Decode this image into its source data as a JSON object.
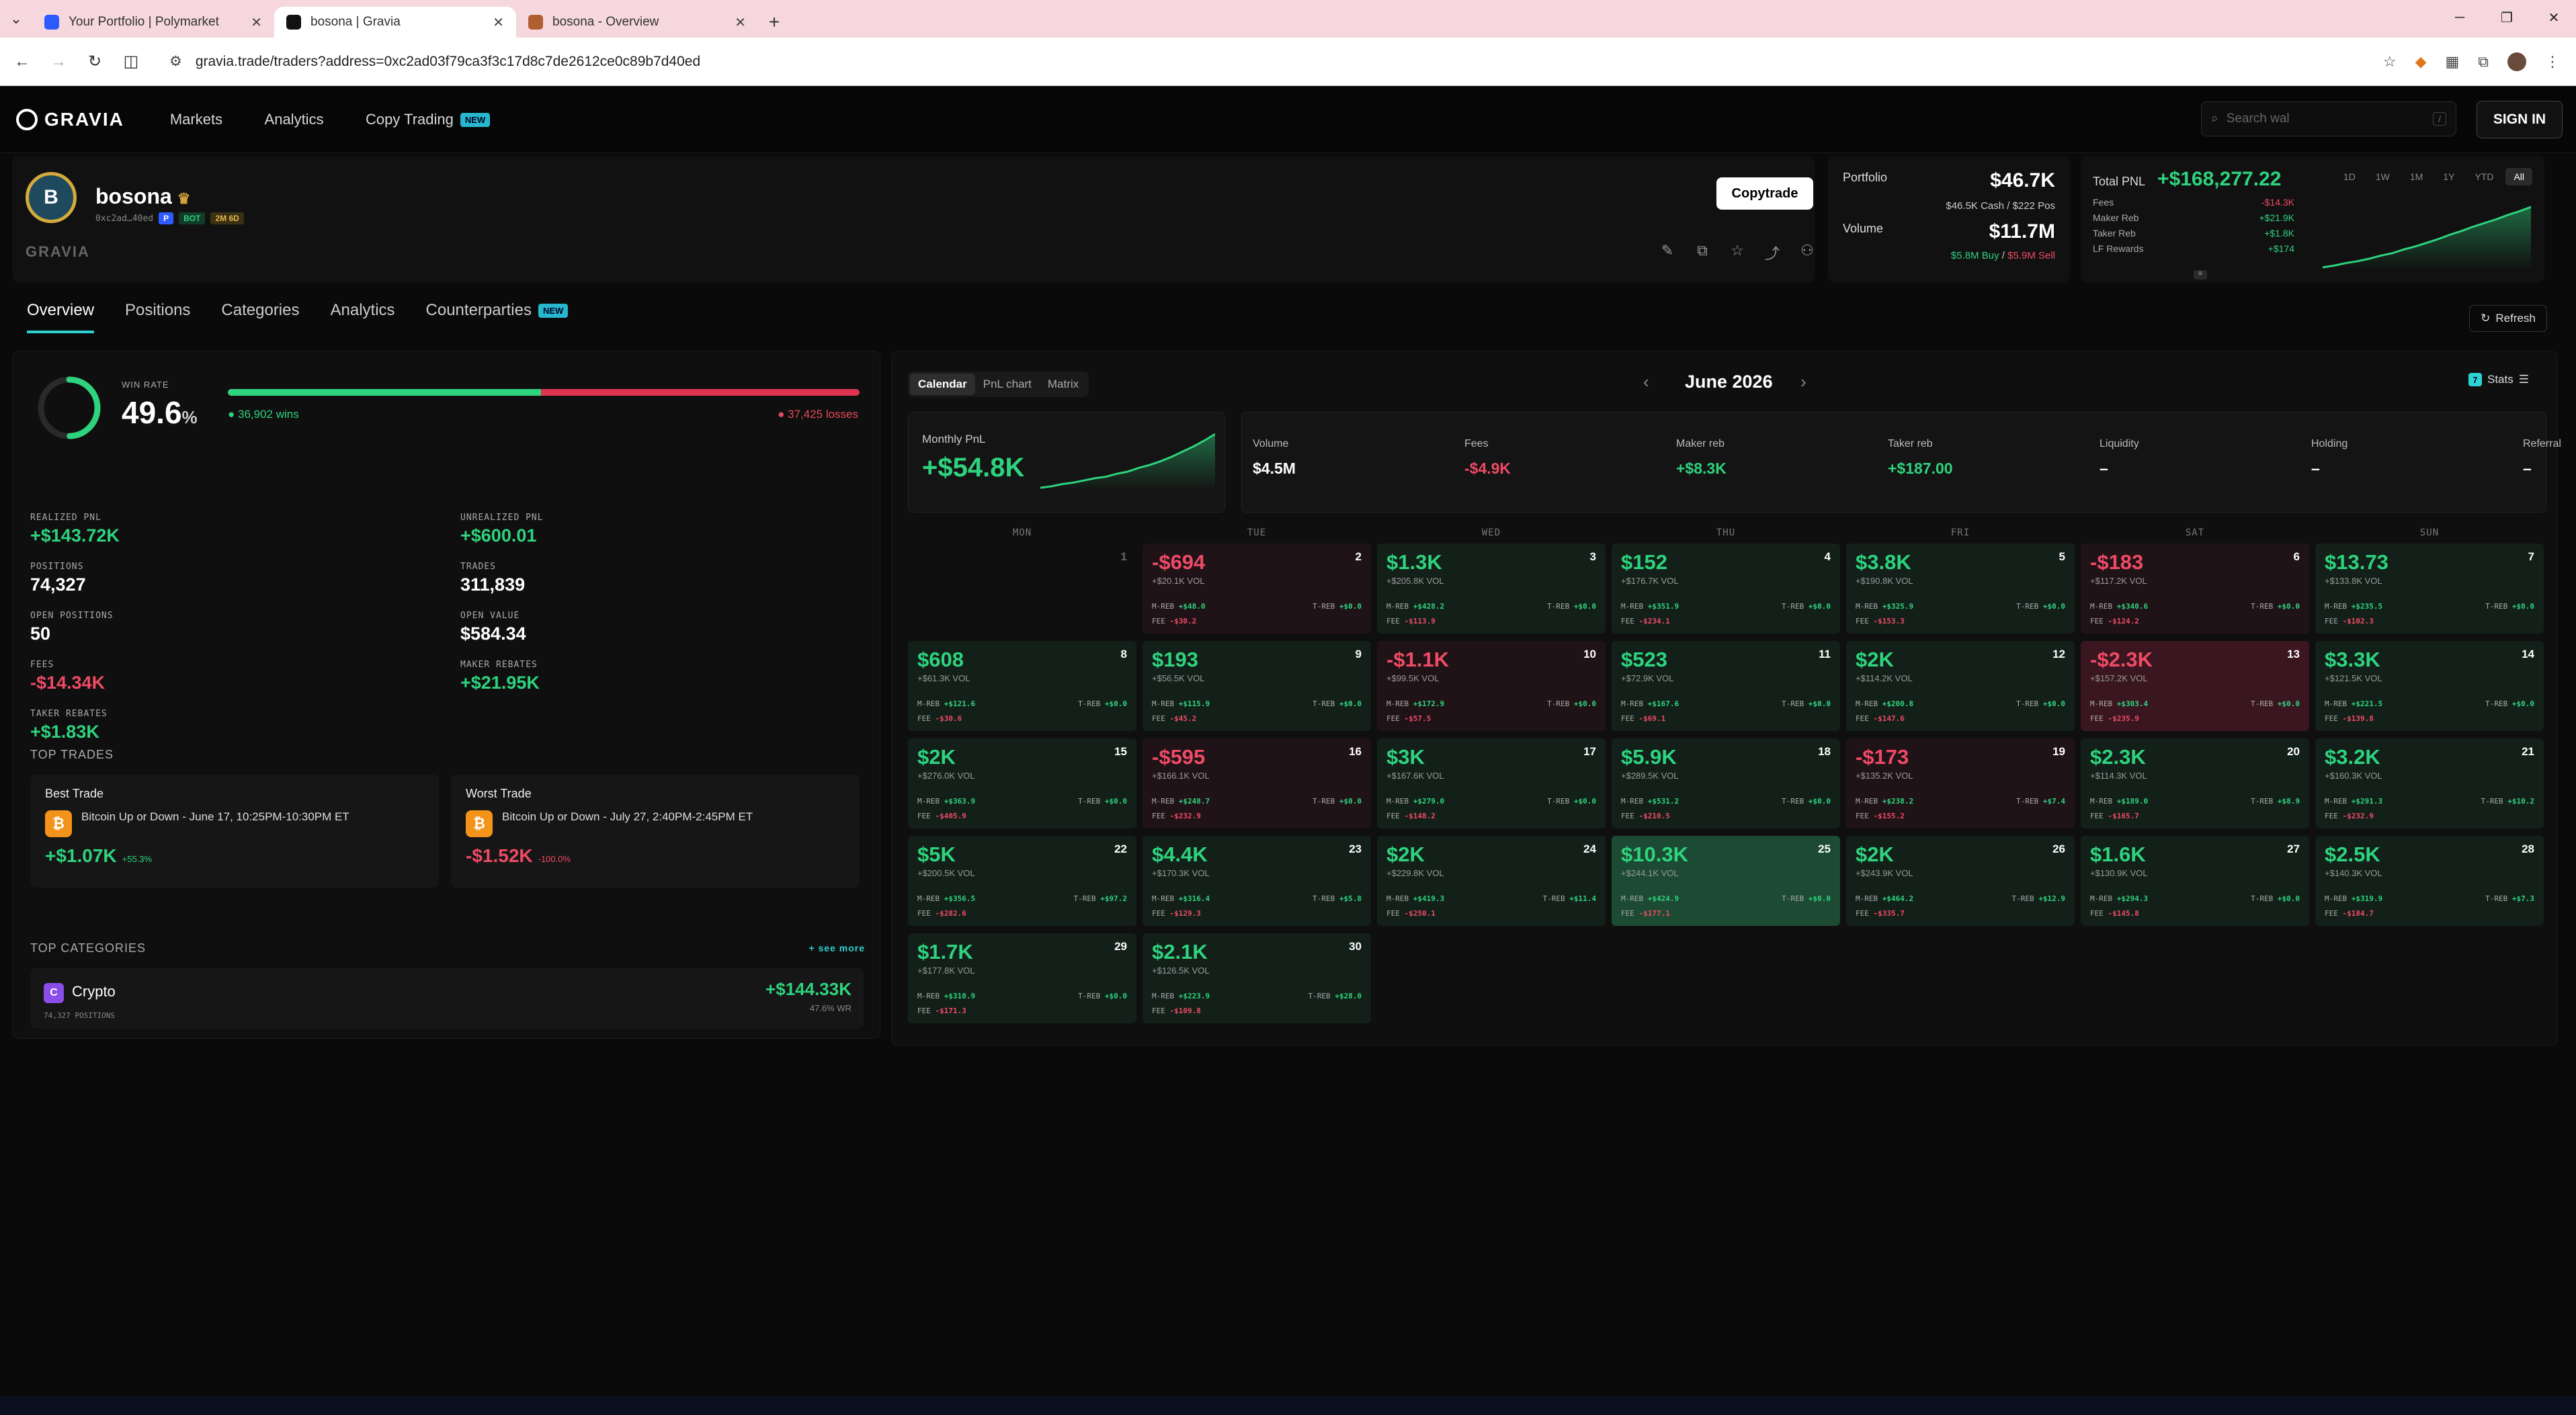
{
  "browser": {
    "tabs": [
      {
        "title": "Your Portfolio | Polymarket",
        "active": false,
        "favicon_color": "#2d5bff"
      },
      {
        "title": "bosona | Gravia",
        "active": true,
        "favicon_color": "#111111"
      },
      {
        "title": "bosona - Overview",
        "active": false,
        "favicon_color": "#b06030"
      }
    ],
    "url": "gravia.trade/traders?address=0xc2ad03f79ca3f3c17d8c7de2612ce0c89b7d40ed"
  },
  "header": {
    "logo": "GRAVIA",
    "nav": [
      "Markets",
      "Analytics",
      "Copy Trading"
    ],
    "new_badge": "NEW",
    "search_placeholder": "Search wal",
    "search_kbd": "/",
    "signin": "SIGN IN"
  },
  "profile": {
    "initial": "B",
    "name": "bosona",
    "address": "0xc2ad…40ed",
    "chips": [
      "BOT",
      "2M 6D"
    ],
    "brand": "GRAVIA",
    "copytrade": "Copytrade"
  },
  "portfolio": {
    "label": "Portfolio",
    "value": "$46.7K",
    "sub": "$46.5K Cash / $222 Pos",
    "volume_label": "Volume",
    "volume": "$11.7M",
    "buy": "$5.8M Buy",
    "sell": "$5.9M Sell"
  },
  "pnl": {
    "label": "Total PNL",
    "value": "+$168,277.22",
    "breakdown": [
      {
        "label": "Fees",
        "value": "-$14.3K",
        "tone": "r"
      },
      {
        "label": "Maker Reb",
        "value": "+$21.9K",
        "tone": "g"
      },
      {
        "label": "Taker Reb",
        "value": "+$1.8K",
        "tone": "g"
      },
      {
        "label": "LF Rewards",
        "value": "+$174",
        "tone": "g"
      }
    ],
    "ranges": [
      "1D",
      "1W",
      "1M",
      "1Y",
      "YTD",
      "All"
    ],
    "active_range": "All",
    "sparkline": [
      2,
      5,
      9,
      12,
      16,
      21,
      25,
      31,
      36,
      42,
      48,
      55,
      61,
      68,
      74,
      80,
      87,
      93,
      100
    ]
  },
  "page_tabs": [
    {
      "label": "Overview",
      "active": true
    },
    {
      "label": "Positions"
    },
    {
      "label": "Categories"
    },
    {
      "label": "Analytics"
    },
    {
      "label": "Counterparties",
      "badge": "NEW"
    }
  ],
  "refresh": "Refresh",
  "overview": {
    "win_rate_label": "WIN RATE",
    "win_rate": "49.6",
    "win_rate_unit": "%",
    "win_fraction": 0.496,
    "wins": "36,902 wins",
    "losses": "37,425 losses",
    "stats": [
      {
        "label": "REALIZED PNL",
        "value": "+$143.72K",
        "tone": "g"
      },
      {
        "label": "UNREALIZED PNL",
        "value": "+$600.01",
        "tone": "g"
      },
      {
        "label": "POSITIONS",
        "value": "74,327",
        "tone": "w"
      },
      {
        "label": "TRADES",
        "value": "311,839",
        "tone": "w"
      },
      {
        "label": "OPEN POSITIONS",
        "value": "50",
        "tone": "w"
      },
      {
        "label": "OPEN VALUE",
        "value": "$584.34",
        "tone": "w"
      },
      {
        "label": "FEES",
        "value": "-$14.34K",
        "tone": "r"
      },
      {
        "label": "MAKER REBATES",
        "value": "+$21.95K",
        "tone": "g"
      },
      {
        "label": "TAKER REBATES",
        "value": "+$1.83K",
        "tone": "g"
      }
    ],
    "top_trades_label": "TOP TRADES",
    "best": {
      "label": "Best Trade",
      "market": "Bitcoin Up or Down - June 17, 10:25PM-10:30PM ET",
      "pnl": "+$1.07K",
      "pct": "+55.3%"
    },
    "worst": {
      "label": "Worst Trade",
      "market": "Bitcoin Up or Down - July 27, 2:40PM-2:45PM ET",
      "pnl": "-$1.52K",
      "pct": "-100.0%"
    },
    "top_categories_label": "TOP CATEGORIES",
    "see_more": "+ see more",
    "category": {
      "icon": "C",
      "name": "Crypto",
      "positions": "74,327 POSITIONS",
      "pnl": "+$144.33K",
      "wr": "47.6% WR"
    }
  },
  "calendar": {
    "views": [
      "Calendar",
      "PnL chart",
      "Matrix"
    ],
    "active_view": "Calendar",
    "month": "June 2026",
    "stats_label": "Stats",
    "monthly_label": "Monthly PnL",
    "monthly_value": "+$54.8K",
    "monthly_spark": [
      2,
      4,
      7,
      9,
      12,
      15,
      17,
      21,
      24,
      29,
      33,
      38,
      44,
      51,
      58,
      66,
      75
    ],
    "summary": [
      {
        "label": "Volume",
        "value": "$4.5M",
        "tone": "w"
      },
      {
        "label": "Fees",
        "value": "-$4.9K",
        "tone": "r"
      },
      {
        "label": "Maker reb",
        "value": "+$8.3K",
        "tone": "g"
      },
      {
        "label": "Taker reb",
        "value": "+$187.00",
        "tone": "g"
      },
      {
        "label": "Liquidity",
        "value": "–",
        "tone": "w"
      },
      {
        "label": "Holding",
        "value": "–",
        "tone": "w"
      },
      {
        "label": "Referral",
        "value": "–",
        "tone": "w"
      }
    ],
    "dow": [
      "MON",
      "TUE",
      "WED",
      "THU",
      "FRI",
      "SAT",
      "SUN"
    ],
    "mr_label": "M-REB",
    "tr_label": "T-REB",
    "fee_label": "FEE",
    "days": [
      {
        "d": "1",
        "empty": true
      },
      {
        "d": "2",
        "pnl": "-$694",
        "vol": "+$20.1K VOL",
        "mr": "+$48.0",
        "tr": "+$0.0",
        "fee": "-$30.2",
        "tone": "neg"
      },
      {
        "d": "3",
        "pnl": "$1.3K",
        "vol": "+$205.8K VOL",
        "mr": "+$428.2",
        "tr": "+$0.0",
        "fee": "-$113.9",
        "tone": "pos"
      },
      {
        "d": "4",
        "pnl": "$152",
        "vol": "+$176.7K VOL",
        "mr": "+$351.9",
        "tr": "+$0.0",
        "fee": "-$234.1",
        "tone": "pos"
      },
      {
        "d": "5",
        "pnl": "$3.8K",
        "vol": "+$190.8K VOL",
        "mr": "+$325.9",
        "tr": "+$0.0",
        "fee": "-$153.3",
        "tone": "pos"
      },
      {
        "d": "6",
        "pnl": "-$183",
        "vol": "+$117.2K VOL",
        "mr": "+$340.6",
        "tr": "+$0.0",
        "fee": "-$124.2",
        "tone": "neg"
      },
      {
        "d": "7",
        "pnl": "$13.73",
        "vol": "+$133.8K VOL",
        "mr": "+$235.5",
        "tr": "+$0.0",
        "fee": "-$102.3",
        "tone": "pos"
      },
      {
        "d": "8",
        "pnl": "$608",
        "vol": "+$61.3K VOL",
        "mr": "+$121.6",
        "tr": "+$0.0",
        "fee": "-$30.6",
        "tone": "pos"
      },
      {
        "d": "9",
        "pnl": "$193",
        "vol": "+$56.5K VOL",
        "mr": "+$115.9",
        "tr": "+$0.0",
        "fee": "-$45.2",
        "tone": "pos"
      },
      {
        "d": "10",
        "pnl": "-$1.1K",
        "vol": "+$99.5K VOL",
        "mr": "+$172.9",
        "tr": "+$0.0",
        "fee": "-$57.5",
        "tone": "neg"
      },
      {
        "d": "11",
        "pnl": "$523",
        "vol": "+$72.9K VOL",
        "mr": "+$167.6",
        "tr": "+$0.0",
        "fee": "-$69.1",
        "tone": "pos"
      },
      {
        "d": "12",
        "pnl": "$2K",
        "vol": "+$114.2K VOL",
        "mr": "+$200.8",
        "tr": "+$0.0",
        "fee": "-$147.6",
        "tone": "pos"
      },
      {
        "d": "13",
        "pnl": "-$2.3K",
        "vol": "+$157.2K VOL",
        "mr": "+$303.4",
        "tr": "+$0.0",
        "fee": "-$235.9",
        "tone": "bigneg"
      },
      {
        "d": "14",
        "pnl": "$3.3K",
        "vol": "+$121.5K VOL",
        "mr": "+$221.5",
        "tr": "+$0.0",
        "fee": "-$139.8",
        "tone": "pos"
      },
      {
        "d": "15",
        "pnl": "$2K",
        "vol": "+$276.0K VOL",
        "mr": "+$363.9",
        "tr": "+$0.0",
        "fee": "-$405.9",
        "tone": "pos"
      },
      {
        "d": "16",
        "pnl": "-$595",
        "vol": "+$166.1K VOL",
        "mr": "+$248.7",
        "tr": "+$0.0",
        "fee": "-$232.9",
        "tone": "neg"
      },
      {
        "d": "17",
        "pnl": "$3K",
        "vol": "+$167.6K VOL",
        "mr": "+$279.0",
        "tr": "+$0.0",
        "fee": "-$148.2",
        "tone": "pos"
      },
      {
        "d": "18",
        "pnl": "$5.9K",
        "vol": "+$289.5K VOL",
        "mr": "+$531.2",
        "tr": "+$0.0",
        "fee": "-$210.5",
        "tone": "pos"
      },
      {
        "d": "19",
        "pnl": "-$173",
        "vol": "+$135.2K VOL",
        "mr": "+$238.2",
        "tr": "+$7.4",
        "fee": "-$155.2",
        "tone": "neg"
      },
      {
        "d": "20",
        "pnl": "$2.3K",
        "vol": "+$114.3K VOL",
        "mr": "+$189.0",
        "tr": "+$8.9",
        "fee": "-$165.7",
        "tone": "pos"
      },
      {
        "d": "21",
        "pnl": "$3.2K",
        "vol": "+$160.3K VOL",
        "mr": "+$291.3",
        "tr": "+$10.2",
        "fee": "-$232.9",
        "tone": "pos"
      },
      {
        "d": "22",
        "pnl": "$5K",
        "vol": "+$200.5K VOL",
        "mr": "+$356.5",
        "tr": "+$97.2",
        "fee": "-$282.6",
        "tone": "pos"
      },
      {
        "d": "23",
        "pnl": "$4.4K",
        "vol": "+$170.3K VOL",
        "mr": "+$316.4",
        "tr": "+$5.8",
        "fee": "-$129.3",
        "tone": "pos"
      },
      {
        "d": "24",
        "pnl": "$2K",
        "vol": "+$229.8K VOL",
        "mr": "+$419.3",
        "tr": "+$11.4",
        "fee": "-$250.1",
        "tone": "pos"
      },
      {
        "d": "25",
        "pnl": "$10.3K",
        "vol": "+$244.1K VOL",
        "mr": "+$424.9",
        "tr": "+$0.0",
        "fee": "-$177.1",
        "tone": "bigpos"
      },
      {
        "d": "26",
        "pnl": "$2K",
        "vol": "+$243.9K VOL",
        "mr": "+$464.2",
        "tr": "+$12.9",
        "fee": "-$335.7",
        "tone": "pos"
      },
      {
        "d": "27",
        "pnl": "$1.6K",
        "vol": "+$130.9K VOL",
        "mr": "+$294.3",
        "tr": "+$0.0",
        "fee": "-$145.8",
        "tone": "pos"
      },
      {
        "d": "28",
        "pnl": "$2.5K",
        "vol": "+$140.3K VOL",
        "mr": "+$319.9",
        "tr": "+$7.3",
        "fee": "-$184.7",
        "tone": "pos"
      },
      {
        "d": "29",
        "pnl": "$1.7K",
        "vol": "+$177.8K VOL",
        "mr": "+$310.9",
        "tr": "+$0.0",
        "fee": "-$171.3",
        "tone": "pos"
      },
      {
        "d": "30",
        "pnl": "$2.1K",
        "vol": "+$126.5K VOL",
        "mr": "+$223.9",
        "tr": "+$28.0",
        "fee": "-$109.8",
        "tone": "pos"
      }
    ]
  }
}
